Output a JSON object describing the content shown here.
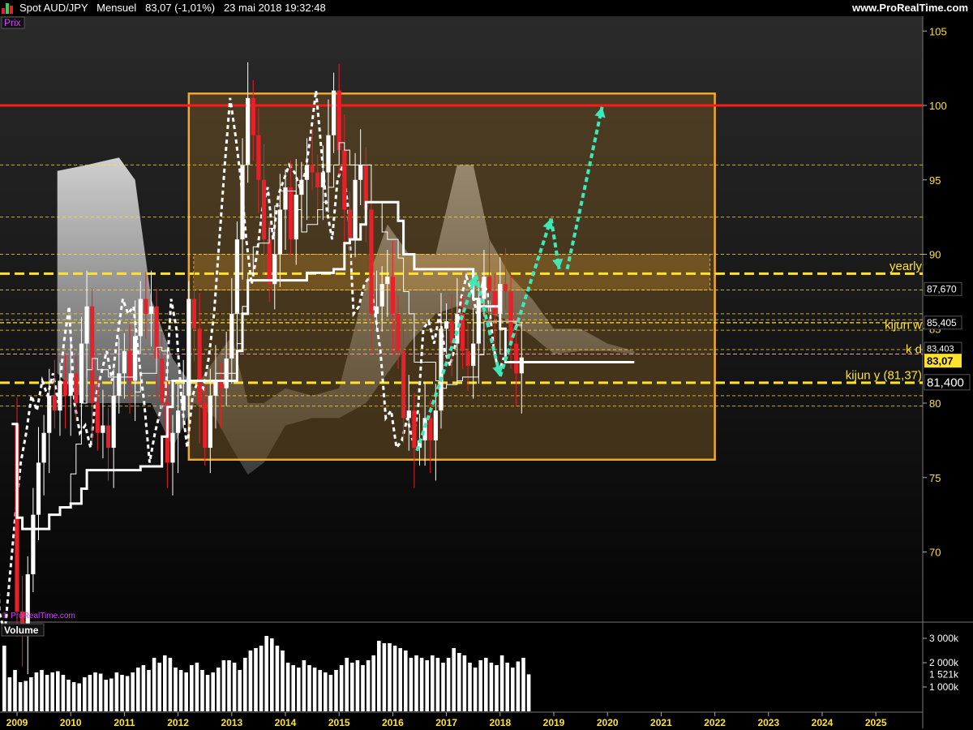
{
  "header": {
    "title": "Spot AUD/JPY   Mensuel   83,07 (-1,01%)   23 mai 2018 19:32:48",
    "site": "www.ProRealTime.com"
  },
  "panels": {
    "price_label": "Prix",
    "volume_label": "Volume",
    "watermark": "© ProRealTime.com"
  },
  "colors": {
    "background": "#000000",
    "bull": "#ffffff",
    "bear": "#e8202a",
    "box_fill": "#6b4f22",
    "box_border": "#f0a830",
    "resistance": "#ff1a1a",
    "yellow": "#ffe22a",
    "arrow": "#3fe8b8"
  },
  "chart_data": [
    {
      "type": "candlestick",
      "title": "Spot AUD/JPY Mensuel",
      "timeframe": "monthly",
      "x_ticks": [
        "2009",
        "2010",
        "2011",
        "2012",
        "2013",
        "2014",
        "2015",
        "2016",
        "2017",
        "2018",
        "2019",
        "2020",
        "2021",
        "2022",
        "2023",
        "2024",
        "2025"
      ],
      "y_ticks": [
        70,
        75,
        80,
        85,
        90,
        95,
        100,
        105
      ],
      "ylim": [
        65,
        106
      ],
      "last_price": 83.07,
      "price_tags": [
        {
          "value": 87.67,
          "text": "87,670"
        },
        {
          "value": 85.405,
          "text": "85,405"
        },
        {
          "value": 83.403,
          "text": "83,403"
        },
        {
          "value": 83.07,
          "text": "83,07"
        },
        {
          "value": 81.4,
          "text": "81,400"
        }
      ],
      "levels": [
        {
          "value": 100,
          "label": "",
          "style": "solid-red"
        },
        {
          "value": 88.7,
          "label": "yearly",
          "style": "dashed-yellow-thick"
        },
        {
          "value": 85.4,
          "label": "kijun w",
          "style": "dashed-yellow-thin"
        },
        {
          "value": 83.3,
          "label": "k d",
          "style": "dashed-pink-thin"
        },
        {
          "value": 81.37,
          "label": "kijun y (81,37)",
          "style": "dashed-yellow-thick"
        }
      ],
      "box": {
        "x_start": 2012.2,
        "x_end": 2022.0,
        "y_low": 76.2,
        "y_high": 100.8
      },
      "series_close": [
        {
          "x": 2008.9,
          "close": 78.6
        },
        {
          "x": 2009.0,
          "close": 66.0
        },
        {
          "x": 2009.1,
          "close": 64.5
        },
        {
          "x": 2009.2,
          "close": 68.5
        },
        {
          "x": 2009.3,
          "close": 72.5
        },
        {
          "x": 2009.4,
          "close": 76.0
        },
        {
          "x": 2009.5,
          "close": 78.0
        },
        {
          "x": 2009.6,
          "close": 80.5
        },
        {
          "x": 2009.7,
          "close": 79.5
        },
        {
          "x": 2009.8,
          "close": 81.5
        },
        {
          "x": 2009.9,
          "close": 80.5
        },
        {
          "x": 2010.0,
          "close": 82.0
        },
        {
          "x": 2010.1,
          "close": 80.0
        },
        {
          "x": 2010.2,
          "close": 84.0
        },
        {
          "x": 2010.3,
          "close": 86.5
        },
        {
          "x": 2010.4,
          "close": 80.0
        },
        {
          "x": 2010.5,
          "close": 78.0
        },
        {
          "x": 2010.6,
          "close": 78.5
        },
        {
          "x": 2010.7,
          "close": 77.0
        },
        {
          "x": 2010.8,
          "close": 80.5
        },
        {
          "x": 2010.9,
          "close": 82.0
        },
        {
          "x": 2011.0,
          "close": 83.5
        },
        {
          "x": 2011.1,
          "close": 81.5
        },
        {
          "x": 2011.2,
          "close": 84.5
        },
        {
          "x": 2011.3,
          "close": 87.0
        },
        {
          "x": 2011.4,
          "close": 86.0
        },
        {
          "x": 2011.5,
          "close": 86.5
        },
        {
          "x": 2011.6,
          "close": 83.0
        },
        {
          "x": 2011.7,
          "close": 80.0
        },
        {
          "x": 2011.8,
          "close": 76.0
        },
        {
          "x": 2011.9,
          "close": 78.0
        },
        {
          "x": 2012.0,
          "close": 79.5
        },
        {
          "x": 2012.1,
          "close": 80.5
        },
        {
          "x": 2012.2,
          "close": 87.0
        },
        {
          "x": 2012.3,
          "close": 85.0
        },
        {
          "x": 2012.4,
          "close": 80.0
        },
        {
          "x": 2012.5,
          "close": 77.0
        },
        {
          "x": 2012.6,
          "close": 80.5
        },
        {
          "x": 2012.7,
          "close": 81.5
        },
        {
          "x": 2012.8,
          "close": 81.0
        },
        {
          "x": 2012.9,
          "close": 83.0
        },
        {
          "x": 2013.0,
          "close": 86.0
        },
        {
          "x": 2013.1,
          "close": 91.0
        },
        {
          "x": 2013.2,
          "close": 96.0
        },
        {
          "x": 2013.3,
          "close": 100.5
        },
        {
          "x": 2013.4,
          "close": 98.0
        },
        {
          "x": 2013.5,
          "close": 95.0
        },
        {
          "x": 2013.6,
          "close": 91.0
        },
        {
          "x": 2013.7,
          "close": 88.0
        },
        {
          "x": 2013.8,
          "close": 90.0
        },
        {
          "x": 2013.9,
          "close": 93.0
        },
        {
          "x": 2014.0,
          "close": 94.5
        },
        {
          "x": 2014.1,
          "close": 91.0
        },
        {
          "x": 2014.2,
          "close": 94.0
        },
        {
          "x": 2014.3,
          "close": 95.0
        },
        {
          "x": 2014.4,
          "close": 96.0
        },
        {
          "x": 2014.5,
          "close": 95.5
        },
        {
          "x": 2014.6,
          "close": 94.5
        },
        {
          "x": 2014.7,
          "close": 95.5
        },
        {
          "x": 2014.8,
          "close": 98.0
        },
        {
          "x": 2014.9,
          "close": 101.0
        },
        {
          "x": 2015.0,
          "close": 97.0
        },
        {
          "x": 2015.1,
          "close": 93.0
        },
        {
          "x": 2015.2,
          "close": 91.0
        },
        {
          "x": 2015.3,
          "close": 95.0
        },
        {
          "x": 2015.4,
          "close": 96.0
        },
        {
          "x": 2015.5,
          "close": 93.0
        },
        {
          "x": 2015.6,
          "close": 86.0
        },
        {
          "x": 2015.7,
          "close": 86.5
        },
        {
          "x": 2015.8,
          "close": 88.0
        },
        {
          "x": 2015.9,
          "close": 88.5
        },
        {
          "x": 2016.0,
          "close": 86.0
        },
        {
          "x": 2016.1,
          "close": 83.5
        },
        {
          "x": 2016.2,
          "close": 79.0
        },
        {
          "x": 2016.3,
          "close": 79.5
        },
        {
          "x": 2016.4,
          "close": 77.0
        },
        {
          "x": 2016.5,
          "close": 77.5
        },
        {
          "x": 2016.6,
          "close": 79.0
        },
        {
          "x": 2016.7,
          "close": 77.5
        },
        {
          "x": 2016.8,
          "close": 79.5
        },
        {
          "x": 2016.9,
          "close": 85.0
        },
        {
          "x": 2017.0,
          "close": 85.5
        },
        {
          "x": 2017.1,
          "close": 84.0
        },
        {
          "x": 2017.2,
          "close": 86.0
        },
        {
          "x": 2017.3,
          "close": 83.5
        },
        {
          "x": 2017.4,
          "close": 82.5
        },
        {
          "x": 2017.5,
          "close": 84.0
        },
        {
          "x": 2017.6,
          "close": 87.0
        },
        {
          "x": 2017.7,
          "close": 88.5
        },
        {
          "x": 2017.8,
          "close": 87.5
        },
        {
          "x": 2017.9,
          "close": 86.0
        },
        {
          "x": 2018.0,
          "close": 88.0
        },
        {
          "x": 2018.1,
          "close": 87.5
        },
        {
          "x": 2018.2,
          "close": 84.0
        },
        {
          "x": 2018.3,
          "close": 82.0
        },
        {
          "x": 2018.4,
          "close": 83.07
        }
      ],
      "volume": {
        "y_ticks": [
          {
            "value": 1000,
            "text": "1 000k"
          },
          {
            "value": 2000,
            "text": "2 000k"
          },
          {
            "value": 3000,
            "text": "3 000k"
          }
        ],
        "last": {
          "value": 1521,
          "text": "1 521k"
        },
        "ylim": [
          0,
          3500
        ]
      }
    }
  ]
}
